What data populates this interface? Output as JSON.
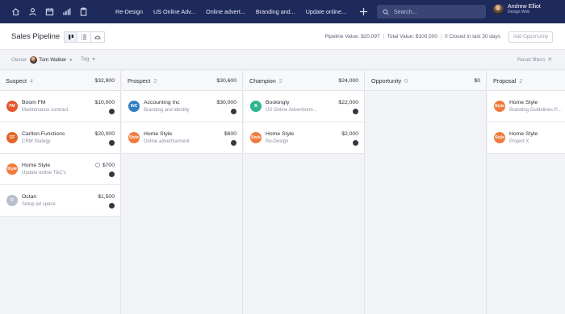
{
  "topbar": {
    "icons": [
      "home-icon",
      "person-icon",
      "calendar-icon",
      "bar-chart-icon",
      "clipboard-icon"
    ],
    "tabs": [
      "Re-Design",
      "US Online Adv...",
      "Online advert...",
      "Branding and...",
      "Update online..."
    ],
    "search_placeholder": "Search...",
    "user": {
      "name": "Andrew Elliot",
      "role": "Design Web"
    }
  },
  "header": {
    "title": "Sales Pipeline",
    "pipeline_value": "Pipeline Value: $20,097",
    "total_value": "Total Value: $100,500",
    "closed": "0 Closed in last 30 days",
    "add_button": "Add Opportunity"
  },
  "filters": {
    "owner_label": "Owner",
    "owner_name": "Tom Walker",
    "tag_label": "Tag",
    "reset_label": "Reset filters"
  },
  "columns": [
    {
      "title": "Suspect",
      "count": "4",
      "total": "$32,900",
      "cards": [
        {
          "title": "Boom FM",
          "sub": "Maintenance contract",
          "amount": "$10,000",
          "logo_text": "FM",
          "logo_color": "#e4572e"
        },
        {
          "title": "Carlton Functions",
          "sub": "CRM Stategy",
          "amount": "$20,000",
          "logo_text": "CF",
          "logo_color": "#e2662a"
        },
        {
          "title": "Home Style",
          "sub": "Update online T&C's",
          "amount": "$700",
          "logo_text": "Style",
          "logo_color": "#f07a3c"
        },
        {
          "title": "Octan",
          "sub": "Setup ad space",
          "amount": "$1,500",
          "logo_text": "O",
          "logo_color": "#b9bfcc"
        }
      ]
    },
    {
      "title": "Prospect",
      "count": "2",
      "total": "$30,600",
      "cards": [
        {
          "title": "Accounting Inc",
          "sub": "Branding and identity",
          "amount": "$30,000",
          "logo_text": "INC",
          "logo_color": "#2f7fc1"
        },
        {
          "title": "Home Style",
          "sub": "Online advertisement",
          "amount": "$600",
          "logo_text": "Style",
          "logo_color": "#f07a3c"
        }
      ]
    },
    {
      "title": "Champion",
      "count": "2",
      "total": "$24,000",
      "cards": [
        {
          "title": "Bookingly",
          "sub": "US Online Advertisem...",
          "amount": "$22,000",
          "logo_text": "B",
          "logo_color": "#2fb58f"
        },
        {
          "title": "Home Style",
          "sub": "Re-Design",
          "amount": "$2,000",
          "logo_text": "Style",
          "logo_color": "#f07a3c"
        }
      ]
    },
    {
      "title": "Opportunity",
      "count": "0",
      "total": "$0",
      "cards": []
    },
    {
      "title": "Proposal",
      "count": "2",
      "total": "",
      "cards": [
        {
          "title": "Home Style",
          "sub": "Branding Guidelines P...",
          "amount": "",
          "logo_text": "Style",
          "logo_color": "#f07a3c"
        },
        {
          "title": "Home Style",
          "sub": "Project X",
          "amount": "",
          "logo_text": "Style",
          "logo_color": "#f07a3c"
        }
      ]
    }
  ]
}
